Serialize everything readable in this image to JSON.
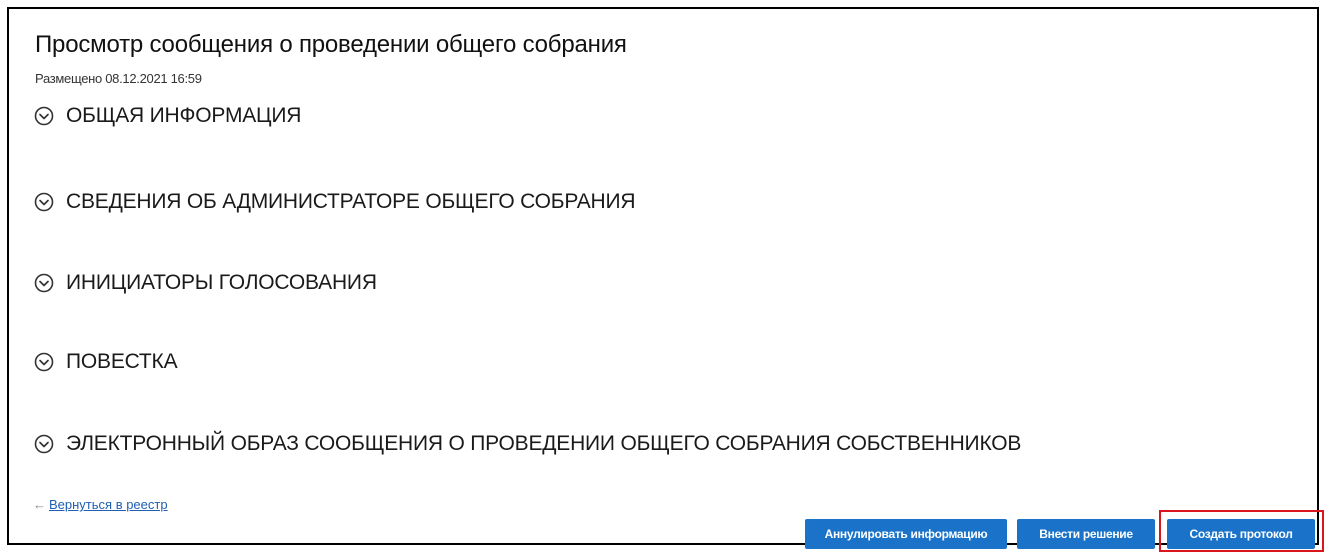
{
  "header": {
    "title": "Просмотр сообщения о проведении общего собрания",
    "posted": "Размещено 08.12.2021 16:59"
  },
  "sections": [
    {
      "label": "ОБЩАЯ ИНФОРМАЦИЯ",
      "icon": "chevron-down-circle-icon"
    },
    {
      "label": "СВЕДЕНИЯ ОБ АДМИНИСТРАТОРЕ ОБЩЕГО СОБРАНИЯ",
      "icon": "chevron-down-circle-icon"
    },
    {
      "label": "ИНИЦИАТОРЫ ГОЛОСОВАНИЯ",
      "icon": "chevron-down-circle-icon"
    },
    {
      "label": "ПОВЕСТКА",
      "icon": "chevron-down-circle-icon"
    },
    {
      "label": "ЭЛЕКТРОННЫЙ ОБРАЗ СООБЩЕНИЯ О ПРОВЕДЕНИИ ОБЩЕГО СОБРАНИЯ СОБСТВЕННИКОВ",
      "icon": "chevron-down-circle-icon"
    }
  ],
  "footer": {
    "back_arrow": "←",
    "back_label": "Вернуться в реестр",
    "annul_label": "Аннулировать информацию",
    "decision_label": "Внести решение",
    "protocol_label": "Создать протокол"
  },
  "colors": {
    "primary_button": "#1a73c9",
    "highlight_border": "#d9161d",
    "link": "#1f5fb4"
  }
}
